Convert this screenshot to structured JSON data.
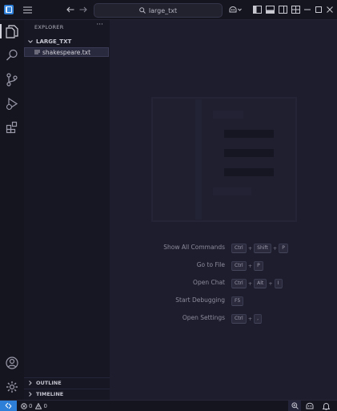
{
  "titlebar": {
    "search_text": "large_txt"
  },
  "sidebar": {
    "title": "EXPLORER",
    "more": "···",
    "folder": "LARGE_TXT",
    "file": "shakespeare.txt",
    "sections": [
      "OUTLINE",
      "TIMELINE"
    ]
  },
  "editor": {
    "shortcuts": [
      {
        "label": "Show All Commands",
        "keys": [
          "Ctrl",
          "Shift",
          "P"
        ]
      },
      {
        "label": "Go to File",
        "keys": [
          "Ctrl",
          "P"
        ]
      },
      {
        "label": "Open Chat",
        "keys": [
          "Ctrl",
          "Alt",
          "I"
        ]
      },
      {
        "label": "Start Debugging",
        "keys": [
          "F5"
        ]
      },
      {
        "label": "Open Settings",
        "keys": [
          "Ctrl",
          ","
        ]
      }
    ],
    "plus": "+"
  },
  "statusbar": {
    "errors": "0",
    "warnings": "0"
  },
  "colors": {
    "accent": "#2d7fd8",
    "background": "#1d1d2d",
    "sidebar": "#171724"
  }
}
